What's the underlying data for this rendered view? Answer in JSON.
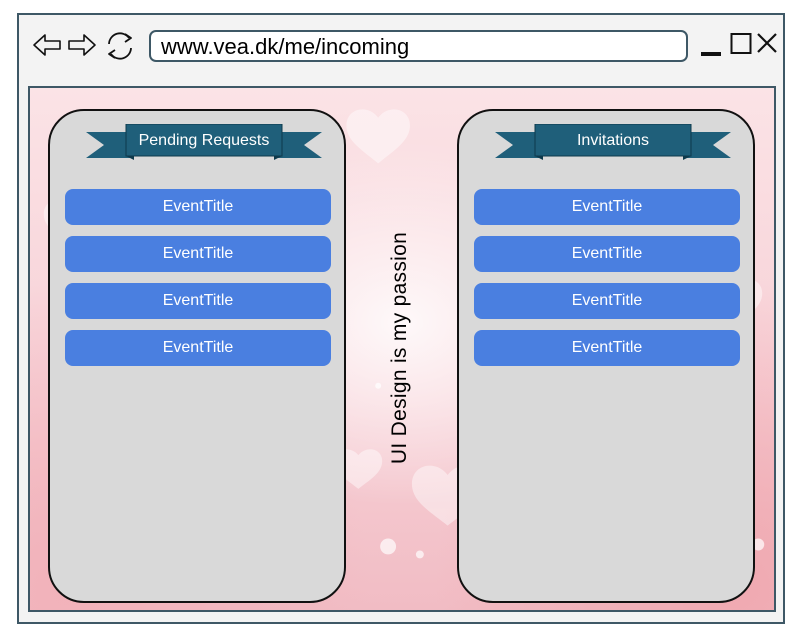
{
  "browser": {
    "url": "www.vea.dk/me/incoming",
    "icons": [
      "back-icon",
      "forward-icon",
      "refresh-icon",
      "minimize-icon",
      "maximize-icon",
      "close-icon"
    ]
  },
  "colors": {
    "frame": "#3e5866",
    "panel": "#d9d9d9",
    "ribbon": "#1f5f7a",
    "event_button": "#4a7fe0",
    "background": "#f7d0d6"
  },
  "panels": {
    "left": {
      "title": "Pending Requests",
      "events": [
        "EventTitle",
        "EventTitle",
        "EventTitle",
        "EventTitle"
      ]
    },
    "right": {
      "title": "Invitations",
      "events": [
        "EventTitle",
        "EventTitle",
        "EventTitle",
        "EventTitle"
      ]
    }
  },
  "tagline": "UI Design is my passion"
}
